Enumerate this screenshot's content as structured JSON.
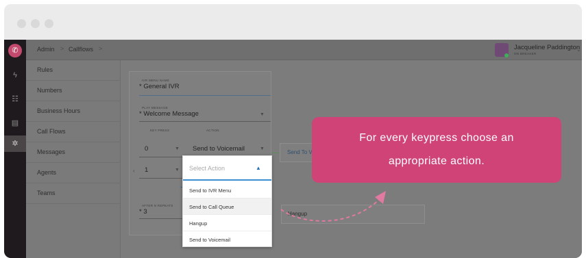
{
  "window": {
    "controls": [
      "close",
      "minimize",
      "maximize"
    ]
  },
  "rail": {
    "icons": [
      "phone-logo-icon",
      "bolt-icon",
      "users-icon",
      "card-icon",
      "gear-icon"
    ]
  },
  "topbar": {
    "breadcrumb": [
      "Admin",
      "Callflows"
    ],
    "separator": ">",
    "user_name": "Jacqueline Paddington",
    "user_status": "ON BREAKER"
  },
  "subnav": {
    "items": [
      "Rules",
      "Numbers",
      "Business Hours",
      "Call Flows",
      "Messages",
      "Agents",
      "Teams"
    ]
  },
  "ivr": {
    "menu_name_label": "IVR MENU NAME",
    "menu_name_value": "* General IVR",
    "play_message_label": "PLAY MESSAGE",
    "play_message_value": "* Welcome Message",
    "col_key_press": "KEY PRESS",
    "col_action": "ACTION",
    "rows": [
      {
        "key": "0",
        "action": "Send to Voicemail",
        "target": "Send To V"
      },
      {
        "key": "1",
        "action": ""
      }
    ],
    "add_symbol": "+",
    "repeats_label": "AFTER N REPEATS",
    "repeats_value": "* 3",
    "repeat_action": "Hangup"
  },
  "dropdown": {
    "placeholder": "Select Action",
    "options": [
      "Send to IVR Menu",
      "Send to Call Queue",
      "Hangup",
      "Send to Voicemail"
    ],
    "hovered": "Send to Call Queue"
  },
  "callout": {
    "line1": "For every keypress choose an",
    "line2": "appropriate action."
  },
  "colors": {
    "accent": "#cf4377",
    "focus": "#3b8fd0",
    "rail": "#1f1a1d",
    "status": "#3fae5a"
  }
}
